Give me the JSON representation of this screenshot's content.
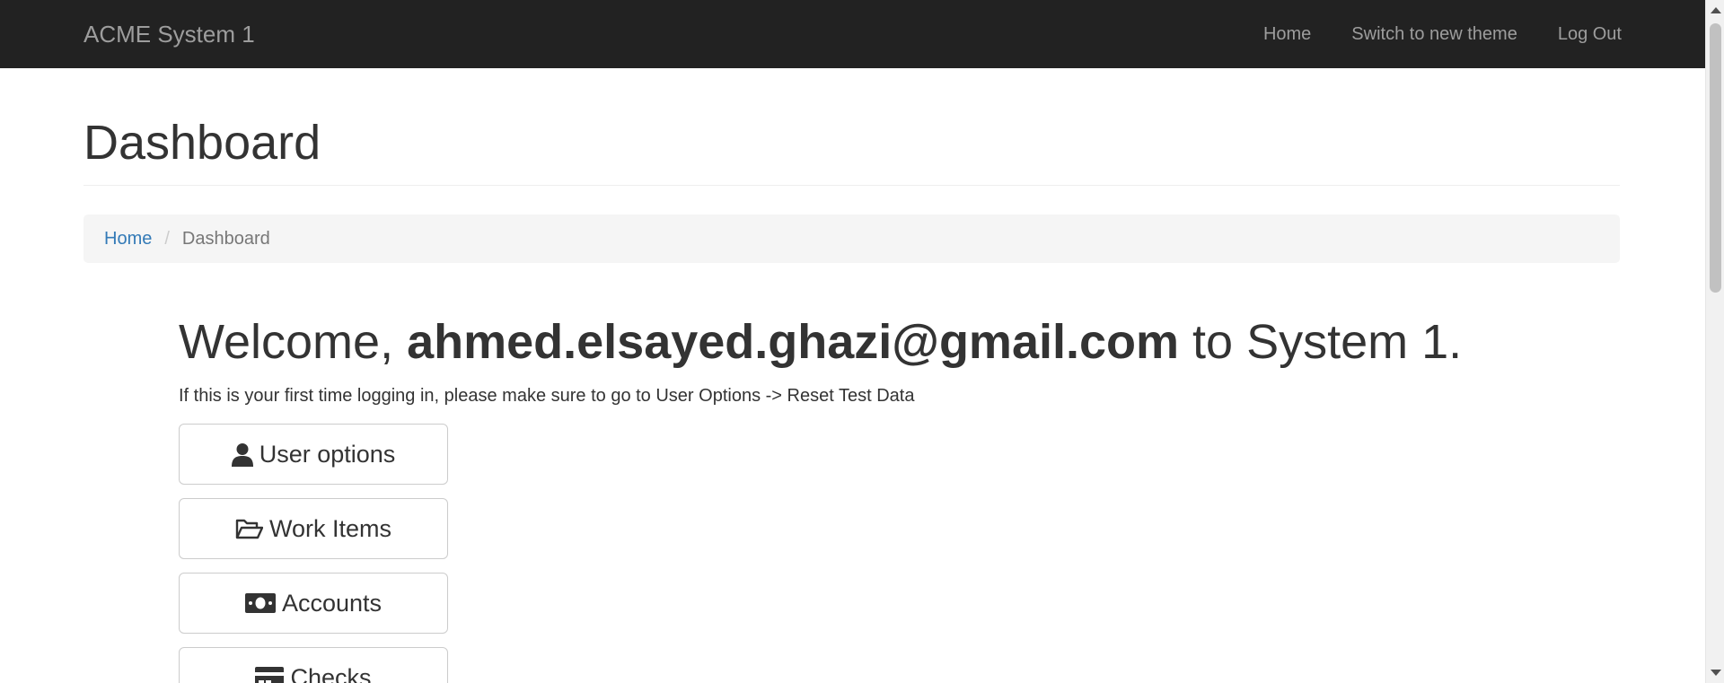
{
  "navbar": {
    "brand": "ACME System 1",
    "links": [
      "Home",
      "Switch to new theme",
      "Log Out"
    ]
  },
  "page": {
    "title": "Dashboard"
  },
  "breadcrumb": {
    "home": "Home",
    "separator": "/",
    "current": "Dashboard"
  },
  "welcome": {
    "prefix": "Welcome, ",
    "email": "ahmed.elsayed.ghazi@gmail.com",
    "suffix": " to System 1."
  },
  "hint": "If this is your first time logging in, please make sure to go to User Options -> Reset Test Data",
  "buttons": [
    {
      "label": "User options",
      "icon": "user-icon"
    },
    {
      "label": "Work Items",
      "icon": "folder-open-icon"
    },
    {
      "label": "Accounts",
      "icon": "money-icon"
    },
    {
      "label": "Checks",
      "icon": "credit-card-icon"
    }
  ],
  "colors": {
    "navbar_bg": "#222222",
    "nav_text": "#9d9d9d",
    "link": "#337ab7",
    "breadcrumb_bg": "#f5f5f5"
  }
}
